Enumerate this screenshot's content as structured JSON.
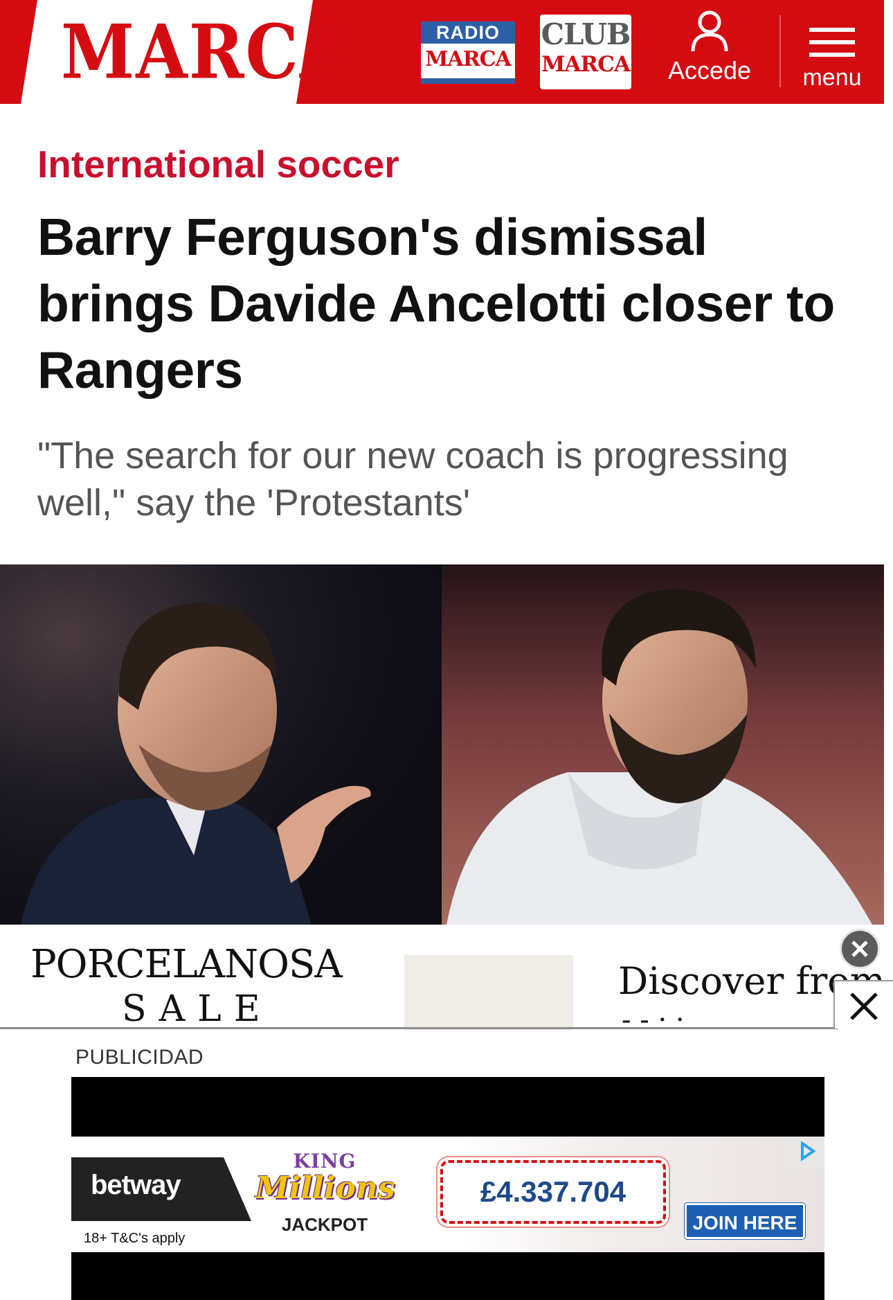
{
  "header": {
    "logo": "MARCA",
    "radio": {
      "top": "RADIO",
      "bottom": "MARCA"
    },
    "club": {
      "top": "CLUB",
      "bottom": "MARCA"
    },
    "accede_label": "Accede",
    "menu_label": "menu",
    "brand_color": "#d50b12"
  },
  "article": {
    "kicker": "International soccer",
    "title": "Barry Ferguson's dismissal brings Davide Ancelotti closer to Rangers",
    "subtitle": "\"The search for our new coach is progressing well,\" say the 'Protestants'"
  },
  "ad_porcelanosa": {
    "brand": "PORCELANOSA",
    "sale": "SALE",
    "discover": "Discover from",
    "close_icon": "close-icon",
    "dismiss_icon": "circle-close-icon"
  },
  "publicidad_label": "PUBLICIDAD",
  "ad_betway": {
    "brand": "betway",
    "tc": "18+ T&C's apply",
    "game_top": "KING",
    "game_bottom": "Millions",
    "jackpot_label": "JACKPOT",
    "jackpot_value": "£4.337.704",
    "cta": "JOIN HERE",
    "adchoices_icon": "adchoices-icon"
  }
}
